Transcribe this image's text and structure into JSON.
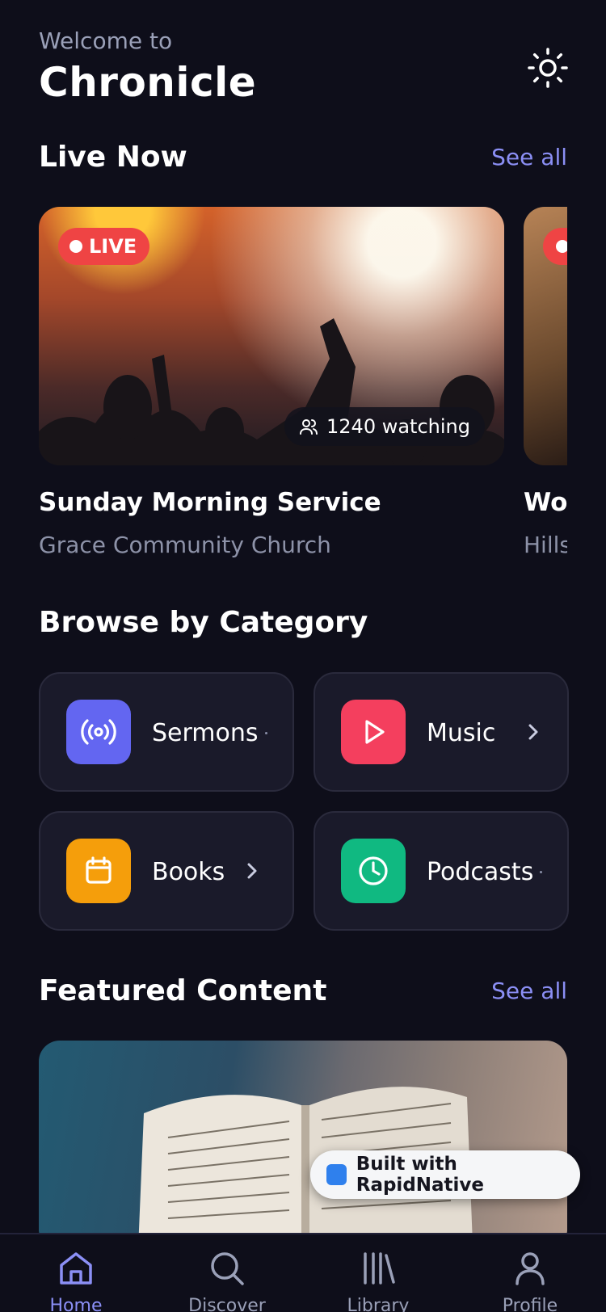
{
  "header": {
    "welcome": "Welcome to",
    "title": "Chronicle",
    "theme_icon": "sun-icon"
  },
  "live": {
    "section_title": "Live Now",
    "see_all": "See all",
    "cards": [
      {
        "badge": "LIVE",
        "watching": "1240 watching",
        "title": "Sunday Morning Service",
        "subtitle": "Grace Community Church"
      },
      {
        "badge": "LIVE",
        "title": "Wo",
        "subtitle": "Hills"
      }
    ]
  },
  "categories": {
    "section_title": "Browse by Category",
    "items": [
      {
        "label": "Sermons",
        "icon": "broadcast-icon",
        "color": "#6366f1"
      },
      {
        "label": "Music",
        "icon": "play-icon",
        "color": "#f43f5e"
      },
      {
        "label": "Books",
        "icon": "calendar-icon",
        "color": "#f59e0b"
      },
      {
        "label": "Podcasts",
        "icon": "clock-icon",
        "color": "#10b981"
      }
    ]
  },
  "featured": {
    "section_title": "Featured Content",
    "see_all": "See all"
  },
  "badge": {
    "text": "Built with RapidNative"
  },
  "tabs": [
    {
      "label": "Home",
      "icon": "home-icon",
      "active": true
    },
    {
      "label": "Discover",
      "icon": "search-icon"
    },
    {
      "label": "Library",
      "icon": "library-icon"
    },
    {
      "label": "Profile",
      "icon": "user-icon"
    }
  ],
  "colors": {
    "accent": "#8b8ff5",
    "background": "#0e0e1a",
    "live": "#ef4444"
  }
}
